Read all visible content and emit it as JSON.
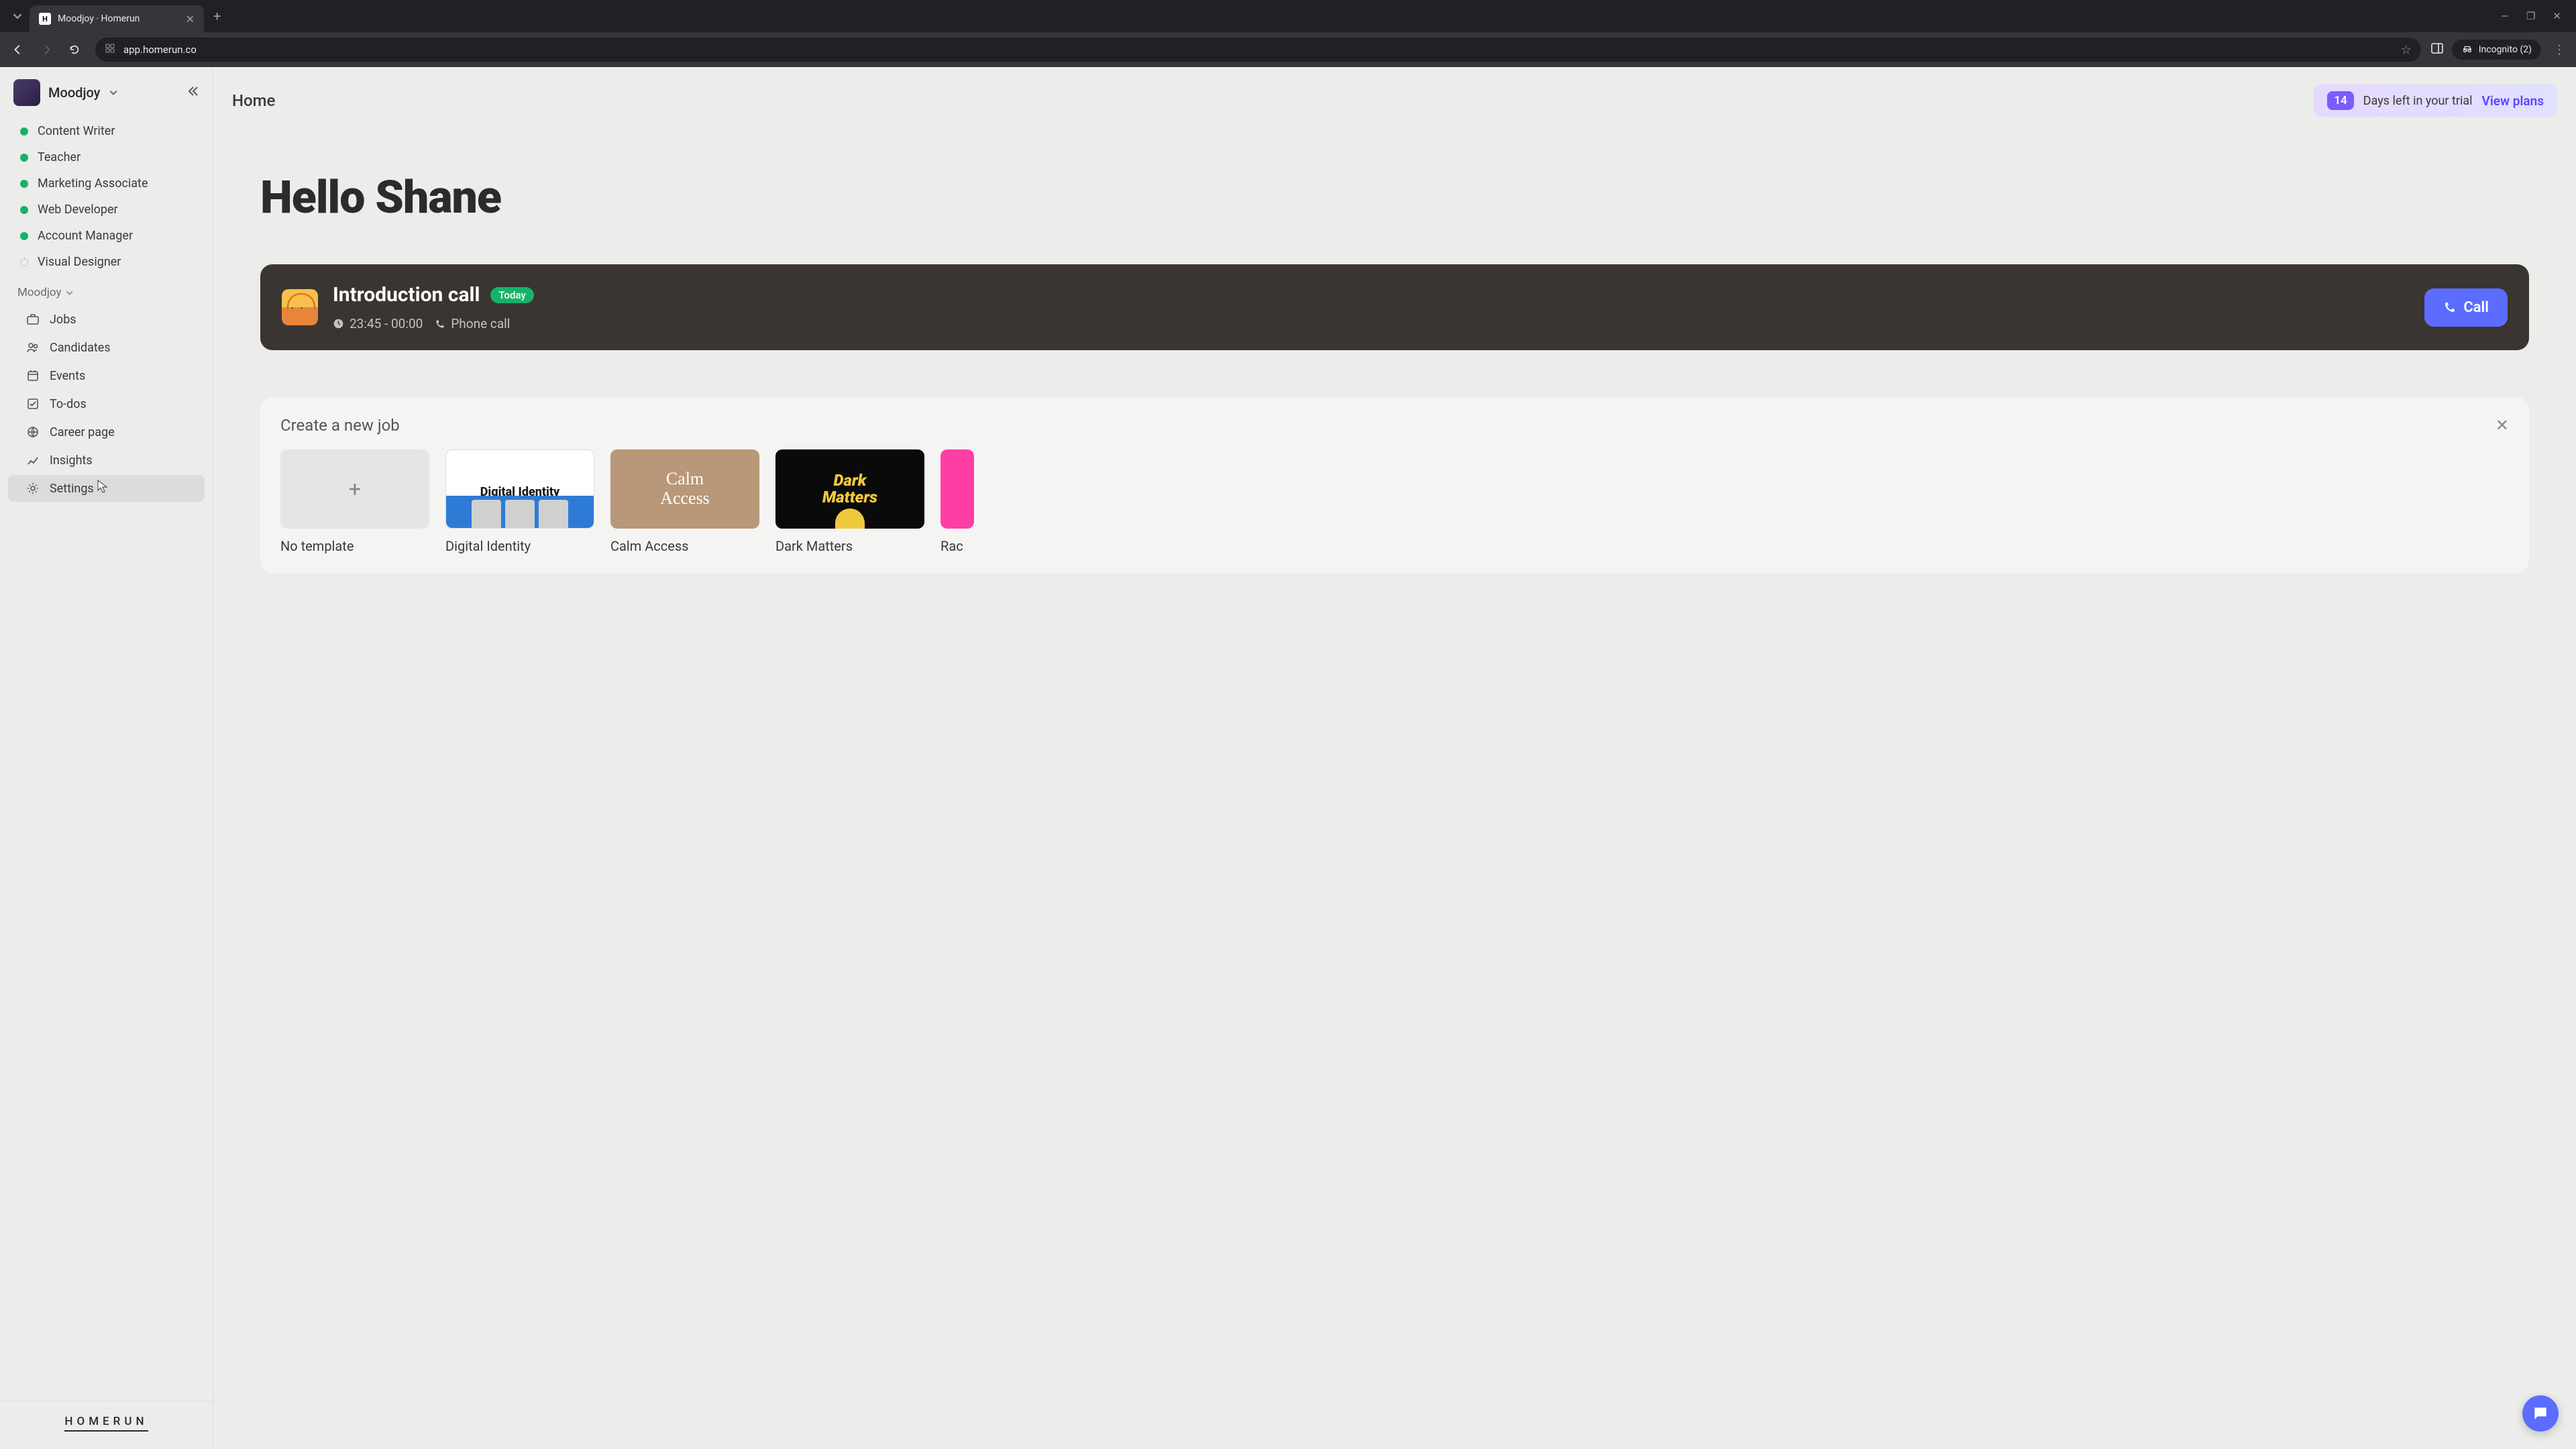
{
  "browser": {
    "tab_title": "Moodjoy · Homerun",
    "url": "app.homerun.co",
    "incognito": "Incognito (2)"
  },
  "sidebar": {
    "workspace": "Moodjoy",
    "jobs": [
      {
        "label": "Content Writer",
        "status": "active"
      },
      {
        "label": "Teacher",
        "status": "active"
      },
      {
        "label": "Marketing Associate",
        "status": "active"
      },
      {
        "label": "Web Developer",
        "status": "active"
      },
      {
        "label": "Account Manager",
        "status": "active"
      },
      {
        "label": "Visual Designer",
        "status": "draft"
      }
    ],
    "section_label": "Moodjoy",
    "nav": [
      {
        "label": "Jobs",
        "icon": "briefcase"
      },
      {
        "label": "Candidates",
        "icon": "people"
      },
      {
        "label": "Events",
        "icon": "calendar"
      },
      {
        "label": "To-dos",
        "icon": "check"
      },
      {
        "label": "Career page",
        "icon": "globe"
      },
      {
        "label": "Insights",
        "icon": "chart"
      },
      {
        "label": "Settings",
        "icon": "gear",
        "active": true
      }
    ],
    "footer_logo": "HOMERUN"
  },
  "topbar": {
    "title": "Home",
    "trial_days": "14",
    "trial_text": "Days left in your trial",
    "trial_link": "View plans"
  },
  "main": {
    "greeting": "Hello Shane",
    "call": {
      "title": "Introduction call",
      "badge": "Today",
      "time": "23:45 - 00:00",
      "type": "Phone call",
      "button": "Call"
    },
    "create_job": {
      "title": "Create a new job",
      "templates": [
        {
          "label": "No template",
          "kind": "blank"
        },
        {
          "label": "Digital Identity",
          "kind": "digital"
        },
        {
          "label": "Calm Access",
          "kind": "calm"
        },
        {
          "label": "Dark Matters",
          "kind": "dark"
        },
        {
          "label": "Rac",
          "kind": "pink"
        }
      ]
    }
  }
}
